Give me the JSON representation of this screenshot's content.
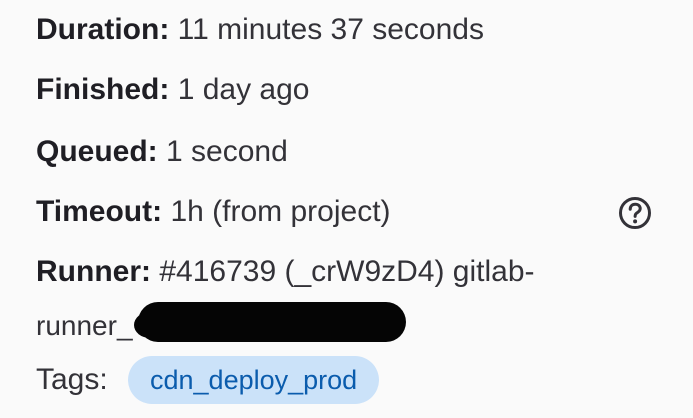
{
  "job_details": {
    "duration": {
      "label": "Duration:",
      "value": "11 minutes 37 seconds"
    },
    "finished": {
      "label": "Finished:",
      "value": "1 day ago"
    },
    "queued": {
      "label": "Queued:",
      "value": "1 second"
    },
    "timeout": {
      "label": "Timeout:",
      "value": "1h (from project)"
    },
    "runner": {
      "label": "Runner:",
      "value_line1": "#416739 (_crW9zD4) gitlab-",
      "value_line2": "runner_"
    },
    "tags": {
      "label": "Tags:",
      "items": [
        "cdn_deploy_prod"
      ]
    }
  },
  "icons": {
    "timeout_help": "question-circle-icon"
  },
  "colors": {
    "text": "#333238",
    "label": "#1f1e24",
    "tag_background": "#cbe2f9",
    "tag_text": "#0b5cad",
    "redaction": "#050505"
  }
}
